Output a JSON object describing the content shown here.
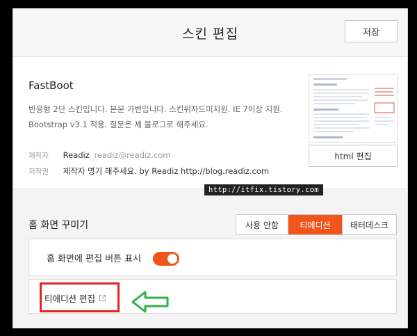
{
  "header": {
    "title": "스킨 편집",
    "save_label": "저장"
  },
  "skin": {
    "name": "FastBoot",
    "description": "반응형 2단 스킨입니다. 본문 가변입니다. 스킨위자드미지원. IE 7이상 지원. Bootstrap v3.1 적용. 질문은 제 블로그로 해주세요.",
    "author_label": "제작자",
    "author_name": "Readiz",
    "author_email": "readiz@readiz.com",
    "copyright_label": "저작권",
    "copyright_value": "제작자 명기 해주세요. by Readiz http://blog.readiz.com",
    "html_edit_label": "html 편집"
  },
  "watermark": "http://itfix.tistory.com",
  "home": {
    "title": "홈 화면 꾸미기",
    "tabs": [
      {
        "label": "사용 안함",
        "active": false
      },
      {
        "label": "티에디션",
        "active": true
      },
      {
        "label": "태터데스크",
        "active": false
      }
    ],
    "toggle_label": "홈 화면에 편집 버튼 표시",
    "toggle_on": true,
    "tedition_link_label": "티에디션 편집"
  },
  "colors": {
    "accent": "#f0561b",
    "highlight_box": "#e32222",
    "arrow": "#2db34a"
  },
  "icons": {
    "external_link": "external-link-icon",
    "arrow": "right-pointing-outline-arrow"
  }
}
